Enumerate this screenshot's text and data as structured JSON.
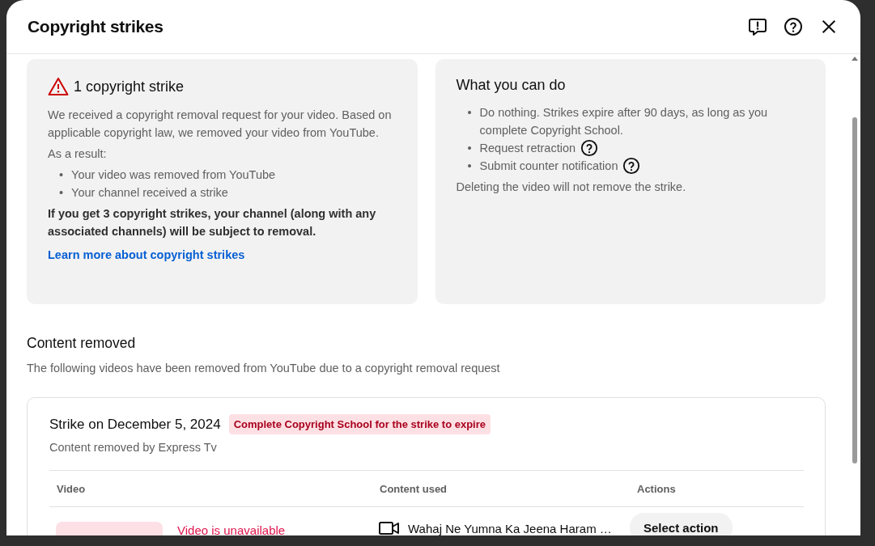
{
  "dialog": {
    "title": "Copyright strikes"
  },
  "strike_summary": {
    "title": "1 copyright strike",
    "description": "We received a copyright removal request for your video. Based on applicable copyright law, we removed your video from YouTube.",
    "result_label": "As a result:",
    "results": [
      {
        "bullet": "•",
        "text": "Your video was removed from YouTube"
      },
      {
        "bullet": "•",
        "text": "Your channel received a strike"
      }
    ],
    "warning": "If you get 3 copyright strikes, your channel (along with any associated channels) will be subject to removal.",
    "link": "Learn more about copyright strikes"
  },
  "what_you_can_do": {
    "title": "What you can do",
    "options": [
      {
        "bullet": "•",
        "text": "Do nothing. Strikes expire after 90 days, as long as you complete Copyright School.",
        "help": false
      },
      {
        "bullet": "•",
        "text": "Request retraction",
        "help": true
      },
      {
        "bullet": "•",
        "text": "Submit counter notification",
        "help": true
      }
    ],
    "note": "Deleting the video will not remove the strike."
  },
  "content_removed": {
    "heading": "Content removed",
    "description": "The following videos have been removed from YouTube due to a copyright removal request"
  },
  "strike": {
    "title": "Strike on December 5, 2024",
    "badge": "Complete Copyright School for the strike to expire",
    "subtitle": "Content removed by Express Tv",
    "columns": [
      "Video",
      "Content used",
      "Actions"
    ],
    "rows": [
      {
        "status": "Video is unavailable",
        "content_used": "Wahaj Ne Yumna Ka Jeena Haram …",
        "action": "Select action"
      }
    ]
  }
}
